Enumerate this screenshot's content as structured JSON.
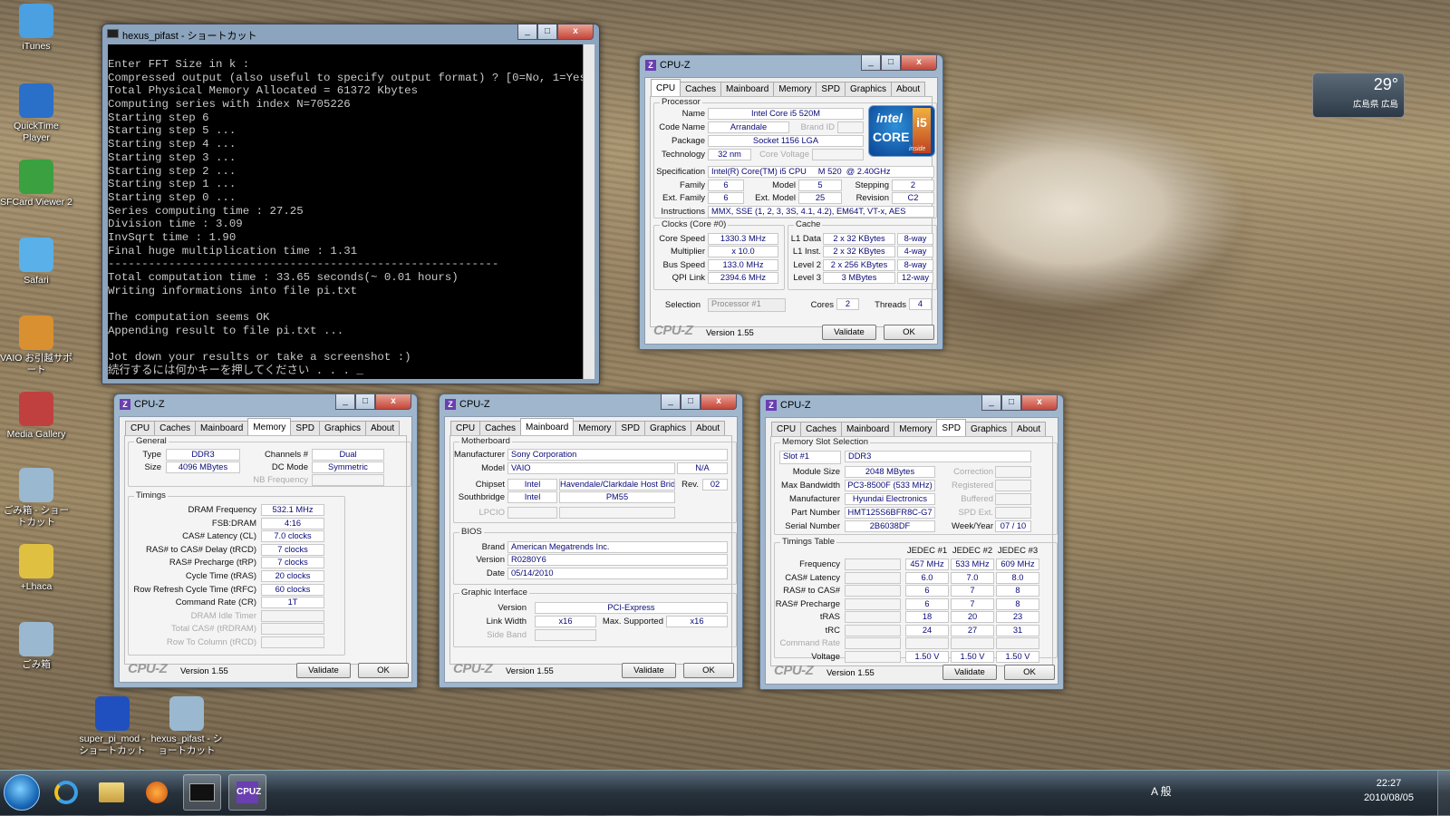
{
  "desktop": {
    "icons": [
      {
        "name": "itunes",
        "label": "iTunes",
        "color": "#4aa0e0"
      },
      {
        "name": "quicktime",
        "label": "QuickTime Player",
        "color": "#2a6fc8"
      },
      {
        "name": "sfcard",
        "label": "SFCard Viewer 2",
        "color": "#3aa040"
      },
      {
        "name": "safari",
        "label": "Safari",
        "color": "#5ab0e8"
      },
      {
        "name": "vaio",
        "label": "VAIO お引越サポート",
        "color": "#d89030"
      },
      {
        "name": "media-gallery",
        "label": "Media Gallery",
        "color": "#c04040"
      },
      {
        "name": "recycle-shortcut",
        "label": "ごみ箱 - ショートカット",
        "color": "#9ab8d0"
      },
      {
        "name": "lhaca",
        "label": "+Lhaca",
        "color": "#e0c040"
      },
      {
        "name": "recycle-bin",
        "label": "ごみ箱",
        "color": "#9ab8d0"
      }
    ],
    "bottom_icons": [
      {
        "name": "superpi",
        "label": "super_pi_mod - ショートカット"
      },
      {
        "name": "hexus",
        "label": "hexus_pifast - ショートカット"
      }
    ]
  },
  "console": {
    "title": "hexus_pifast - ショートカット",
    "lines": [
      "Enter FFT Size in k :",
      "Compressed output (also useful to specify output format) ? [0=No, 1=Yes] :",
      "Total Physical Memory Allocated = 61372 Kbytes",
      "Computing series with index N=705226",
      "Starting step 6",
      "Starting step 5 ...",
      "Starting step 4 ...",
      "Starting step 3 ...",
      "Starting step 2 ...",
      "Starting step 1 ...",
      "Starting step 0 ...",
      "Series computing time : 27.25",
      "Division time : 3.09",
      "InvSqrt time : 1.90",
      "Final huge multiplication time : 1.31",
      "----------------------------------------------------------",
      "Total computation time : 33.65 seconds(~ 0.01 hours)",
      "Writing informations into file pi.txt",
      "",
      "The computation seems OK",
      "Appending result to file pi.txt ...",
      "",
      "Jot down your results or take a screenshot :)",
      "続行するには何かキーを押してください . . . _"
    ]
  },
  "cpuz_common": {
    "title": "CPU-Z",
    "tabs": [
      "CPU",
      "Caches",
      "Mainboard",
      "Memory",
      "SPD",
      "Graphics",
      "About"
    ],
    "brand": "CPU-Z",
    "version": "Version 1.55",
    "validate": "Validate",
    "ok": "OK",
    "min": "_",
    "max": "□",
    "close": "x"
  },
  "cpu": {
    "processor_label": "Processor",
    "name_l": "Name",
    "name": "Intel Core i5 520M",
    "codename_l": "Code Name",
    "codename": "Arrandale",
    "brandid_l": "Brand ID",
    "package_l": "Package",
    "package": "Socket 1156 LGA",
    "tech_l": "Technology",
    "tech": "32 nm",
    "corev_l": "Core Voltage",
    "spec_l": "Specification",
    "spec": "Intel(R) Core(TM) i5 CPU     M 520  @ 2.40GHz",
    "family_l": "Family",
    "family": "6",
    "model_l": "Model",
    "model": "5",
    "stepping_l": "Stepping",
    "stepping": "2",
    "extfam_l": "Ext. Family",
    "extfam": "6",
    "extmodel_l": "Ext. Model",
    "extmodel": "25",
    "revision_l": "Revision",
    "revision": "C2",
    "instr_l": "Instructions",
    "instr": "MMX, SSE (1, 2, 3, 3S, 4.1, 4.2), EM64T, VT-x, AES",
    "clocks_label": "Clocks (Core #0)",
    "corespeed_l": "Core Speed",
    "corespeed": "1330.3 MHz",
    "mult_l": "Multiplier",
    "mult": "x 10.0",
    "bus_l": "Bus Speed",
    "bus": "133.0 MHz",
    "qpi_l": "QPI Link",
    "qpi": "2394.6 MHz",
    "cache_label": "Cache",
    "l1d_l": "L1 Data",
    "l1d": "2 x 32 KBytes",
    "l1d_w": "8-way",
    "l1i_l": "L1 Inst.",
    "l1i": "2 x 32 KBytes",
    "l1i_w": "4-way",
    "l2_l": "Level 2",
    "l2": "2 x 256 KBytes",
    "l2_w": "8-way",
    "l3_l": "Level 3",
    "l3": "3 MBytes",
    "l3_w": "12-way",
    "sel_l": "Selection",
    "sel": "Processor #1",
    "cores_l": "Cores",
    "cores": "2",
    "threads_l": "Threads",
    "threads": "4",
    "intel_1": "intel",
    "intel_2": "CORE",
    "intel_3": "i5",
    "intel_4": "inside"
  },
  "mem": {
    "general": "General",
    "type_l": "Type",
    "type": "DDR3",
    "ch_l": "Channels #",
    "ch": "Dual",
    "size_l": "Size",
    "size": "4096 MBytes",
    "dc_l": "DC Mode",
    "dc": "Symmetric",
    "nb_l": "NB Frequency",
    "timings": "Timings",
    "rows": [
      {
        "l": "DRAM Frequency",
        "v": "532.1 MHz"
      },
      {
        "l": "FSB:DRAM",
        "v": "4:16"
      },
      {
        "l": "CAS# Latency (CL)",
        "v": "7.0 clocks"
      },
      {
        "l": "RAS# to CAS# Delay (tRCD)",
        "v": "7 clocks"
      },
      {
        "l": "RAS# Precharge (tRP)",
        "v": "7 clocks"
      },
      {
        "l": "Cycle Time (tRAS)",
        "v": "20 clocks"
      },
      {
        "l": "Row Refresh Cycle Time (tRFC)",
        "v": "60 clocks"
      },
      {
        "l": "Command Rate (CR)",
        "v": "1T"
      },
      {
        "l": "DRAM Idle Timer",
        "v": ""
      },
      {
        "l": "Total CAS# (tRDRAM)",
        "v": ""
      },
      {
        "l": "Row To Column (tRCD)",
        "v": ""
      }
    ]
  },
  "mb": {
    "mb_label": "Motherboard",
    "manu_l": "Manufacturer",
    "manu": "Sony Corporation",
    "model_l": "Model",
    "model": "VAIO",
    "model2": "N/A",
    "chip_l": "Chipset",
    "chip": "Intel",
    "chip2": "Havendale/Clarkdale Host Bridge",
    "rev_l": "Rev.",
    "rev": "02",
    "sb_l": "Southbridge",
    "sb": "Intel",
    "sb2": "PM55",
    "lpcio_l": "LPCIO",
    "bios_label": "BIOS",
    "brand_l": "Brand",
    "brand": "American Megatrends Inc.",
    "ver_l": "Version",
    "ver": "R0280Y6",
    "date_l": "Date",
    "date": "05/14/2010",
    "gi_label": "Graphic Interface",
    "giver_l": "Version",
    "giver": "PCI-Express",
    "lw_l": "Link Width",
    "lw": "x16",
    "ms_l": "Max. Supported",
    "ms": "x16",
    "sideband_l": "Side Band"
  },
  "spd": {
    "slot_label": "Memory Slot Selection",
    "slot": "Slot #1",
    "slot_type": "DDR3",
    "modsize_l": "Module Size",
    "modsize": "2048 MBytes",
    "corr_l": "Correction",
    "maxbw_l": "Max Bandwidth",
    "maxbw": "PC3-8500F (533 MHz)",
    "reg_l": "Registered",
    "manu_l": "Manufacturer",
    "manu": "Hyundai Electronics",
    "buf_l": "Buffered",
    "part_l": "Part Number",
    "part": "HMT125S6BFR8C-G7",
    "spdext_l": "SPD Ext.",
    "serial_l": "Serial Number",
    "serial": "2B6038DF",
    "week_l": "Week/Year",
    "week": "07 / 10",
    "tt_label": "Timings Table",
    "cols": [
      "JEDEC #1",
      "JEDEC #2",
      "JEDEC #3"
    ],
    "rows": [
      {
        "l": "Frequency",
        "v": [
          "457 MHz",
          "533 MHz",
          "609 MHz"
        ]
      },
      {
        "l": "CAS# Latency",
        "v": [
          "6.0",
          "7.0",
          "8.0"
        ]
      },
      {
        "l": "RAS# to CAS#",
        "v": [
          "6",
          "7",
          "8"
        ]
      },
      {
        "l": "RAS# Precharge",
        "v": [
          "6",
          "7",
          "8"
        ]
      },
      {
        "l": "tRAS",
        "v": [
          "18",
          "20",
          "23"
        ]
      },
      {
        "l": "tRC",
        "v": [
          "24",
          "27",
          "31"
        ]
      },
      {
        "l": "Command Rate",
        "v": [
          "",
          "",
          ""
        ]
      },
      {
        "l": "Voltage",
        "v": [
          "1.50 V",
          "1.50 V",
          "1.50 V"
        ]
      }
    ]
  },
  "weather": {
    "temp": "29°",
    "place": "広島県 広島"
  },
  "taskbar": {
    "time": "22:27",
    "date": "2010/08/05",
    "ime": "A 般"
  }
}
